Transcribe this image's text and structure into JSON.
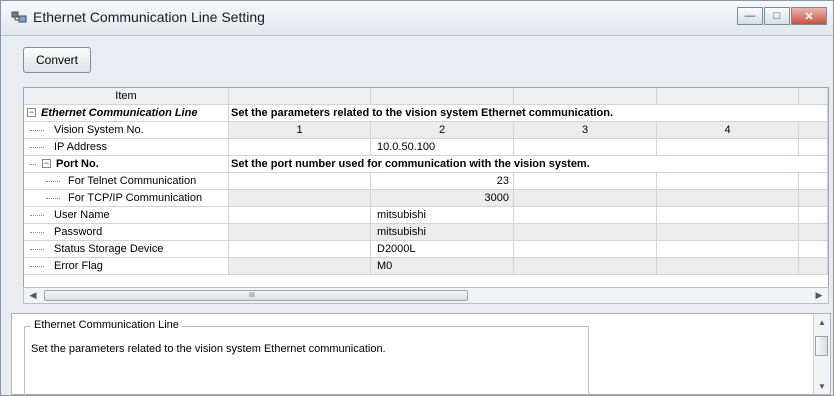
{
  "window": {
    "title": "Ethernet Communication Line Setting"
  },
  "toolbar": {
    "convert_label": "Convert"
  },
  "grid": {
    "header": [
      "Item",
      "",
      "",
      "",
      "",
      ""
    ],
    "rows": [
      {
        "label": "Ethernet Communication Line",
        "span": "Set the parameters related to the vision system Ethernet communication."
      },
      {
        "label": "Vision System No.",
        "c1": "1",
        "c2": "2",
        "c3": "3",
        "c4": "4"
      },
      {
        "label": "IP Address",
        "c2": "10.0.50.100"
      },
      {
        "label": "Port No.",
        "span": "Set the port number used for communication with the vision system."
      },
      {
        "label": "For Telnet Communication",
        "c2": "23"
      },
      {
        "label": "For TCP/IP Communication",
        "c2": "3000"
      },
      {
        "label": "User Name",
        "c2": "mitsubishi"
      },
      {
        "label": "Password",
        "c2": "mitsubishi"
      },
      {
        "label": "Status Storage Device",
        "c2": "D2000L"
      },
      {
        "label": "Error Flag",
        "c2": "M0"
      }
    ]
  },
  "scroll": {
    "grip": "III"
  },
  "description": {
    "title": "Ethernet Communication Line",
    "text": "Set the parameters related to the vision system Ethernet communication."
  },
  "icons": {
    "expand": "minus-box-icon",
    "app": "network-settings-icon"
  }
}
